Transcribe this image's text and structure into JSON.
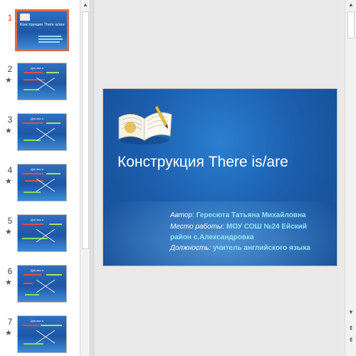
{
  "thumbnails": [
    {
      "number": "1",
      "star": "",
      "heading": "Конструкция There is/are"
    },
    {
      "number": "2",
      "star": "★",
      "heading": "Для вас я"
    },
    {
      "number": "3",
      "star": "★",
      "heading": "Для вас я"
    },
    {
      "number": "4",
      "star": "★",
      "heading": "Для вас я"
    },
    {
      "number": "5",
      "star": "★",
      "heading": "Для вас я"
    },
    {
      "number": "6",
      "star": "★",
      "heading": "Для вас я"
    },
    {
      "number": "7",
      "star": "★",
      "heading": "Для вас я"
    }
  ],
  "slide": {
    "title": "Конструкция There is/are",
    "author_label": "Автор:",
    "author_value": "Гересюта Татьяна Михайловна",
    "workplace_label": "Место работы:",
    "workplace_value": "МОУ СОШ №24   Ейский",
    "workplace_value_2": "район  с.Александровка",
    "position_label": "Должность:",
    "position_value": "учитель английского языка"
  },
  "icons": {
    "up": "▲",
    "down": "▼",
    "prev": "⇞",
    "next": "⇟"
  },
  "colors": {
    "active_outline": "#e8673e",
    "active_number": "#d24726",
    "slide_bg": "#1c5fae",
    "info_value": "#8ee6f6"
  }
}
